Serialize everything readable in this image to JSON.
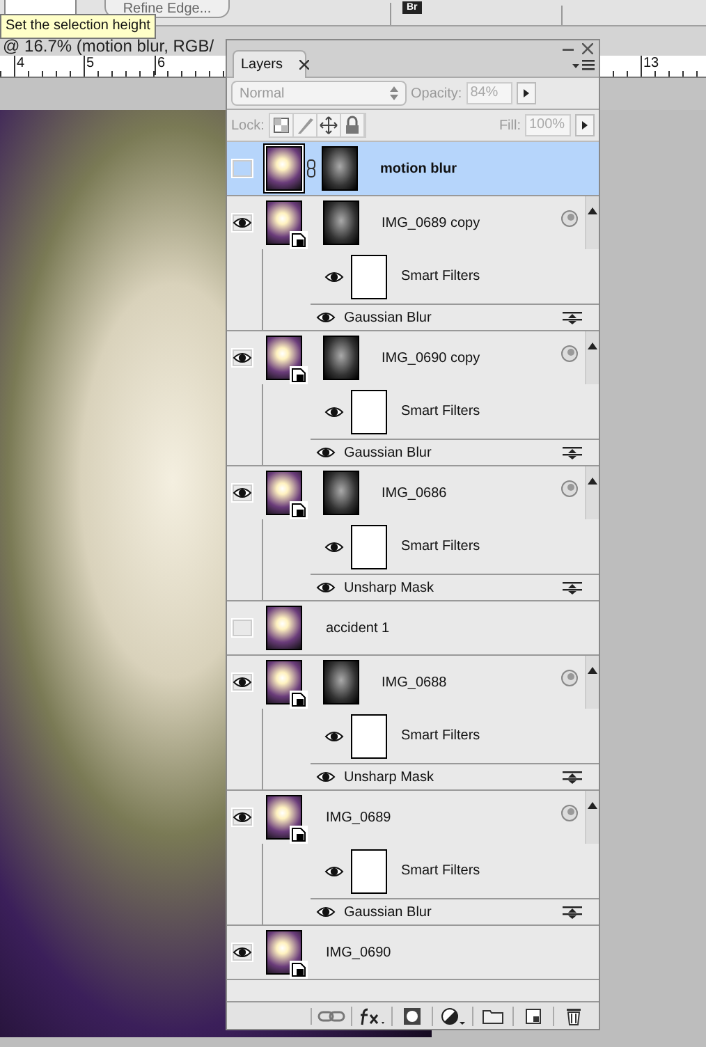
{
  "toolbar": {
    "button": "Refine Edge...",
    "badge": "Br"
  },
  "tooltip": "Set the selection height",
  "document": {
    "title": "@ 16.7% (motion blur, RGB/",
    "ruler_labels": [
      "4",
      "5",
      "6",
      "13"
    ]
  },
  "panel": {
    "tab": "Layers",
    "blend_mode": "Normal",
    "opacity_label": "Opacity:",
    "opacity": "84%",
    "lock_label": "Lock:",
    "fill_label": "Fill:",
    "fill": "100%",
    "layers": [
      {
        "name": "motion blur",
        "visible": false,
        "selected": true,
        "mask": true,
        "linked": true,
        "smart": false
      },
      {
        "name": "IMG_0689 copy",
        "visible": true,
        "selected": false,
        "mask": true,
        "linked": false,
        "smart": true,
        "filters_label": "Smart Filters",
        "filters": [
          {
            "name": "Gaussian Blur",
            "visible": true
          }
        ]
      },
      {
        "name": "IMG_0690 copy",
        "visible": true,
        "selected": false,
        "mask": true,
        "linked": false,
        "smart": true,
        "filters_label": "Smart Filters",
        "filters": [
          {
            "name": "Gaussian Blur",
            "visible": true
          }
        ]
      },
      {
        "name": "IMG_0686",
        "visible": true,
        "selected": false,
        "mask": true,
        "linked": false,
        "smart": true,
        "filters_label": "Smart Filters",
        "filters": [
          {
            "name": "Unsharp Mask",
            "visible": true
          }
        ]
      },
      {
        "name": "accident 1",
        "visible": false,
        "selected": false,
        "mask": false,
        "linked": false,
        "smart": false
      },
      {
        "name": "IMG_0688",
        "visible": true,
        "selected": false,
        "mask": true,
        "linked": false,
        "smart": true,
        "filters_label": "Smart Filters",
        "filters": [
          {
            "name": "Unsharp Mask",
            "visible": true
          }
        ]
      },
      {
        "name": "IMG_0689",
        "visible": true,
        "selected": false,
        "mask": false,
        "linked": false,
        "smart": true,
        "filters_label": "Smart Filters",
        "filters": [
          {
            "name": "Gaussian Blur",
            "visible": true
          }
        ]
      },
      {
        "name": "IMG_0690",
        "visible": true,
        "selected": false,
        "mask": false,
        "linked": false,
        "smart": true
      }
    ]
  }
}
